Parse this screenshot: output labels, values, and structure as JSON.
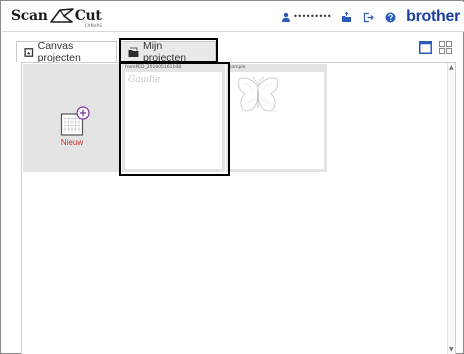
{
  "app": {
    "logo_scan": "Scan",
    "logo_cut": "Cut",
    "logo_sub": "CANVAS",
    "username": "•••••••••",
    "brand": "brother"
  },
  "header_icons": [
    "user-icon",
    "upload-icon",
    "logout-icon",
    "help-icon"
  ],
  "tabs": [
    {
      "label": "Canvas projecten",
      "icon": "canvas-icon",
      "selected": false
    },
    {
      "label": "Mijn projecten",
      "icon": "folder-icon",
      "selected": true
    }
  ],
  "view_toggles": [
    "single-view-icon",
    "grid-view-icon"
  ],
  "cards": {
    "new": {
      "label": "Nieuw",
      "icon": "new-project-icon"
    },
    "project": {
      "title": "fromPED_20160516110B",
      "thumb_text": "Gaudie"
    },
    "sample": {
      "title": "sample",
      "thumb_icon": "butterfly-icon"
    }
  },
  "colors": {
    "brand": "#1a3f9c",
    "new_label": "#d0302c",
    "accent_plus": "#7b2f9e",
    "card_bg": "#e4e4e4"
  }
}
